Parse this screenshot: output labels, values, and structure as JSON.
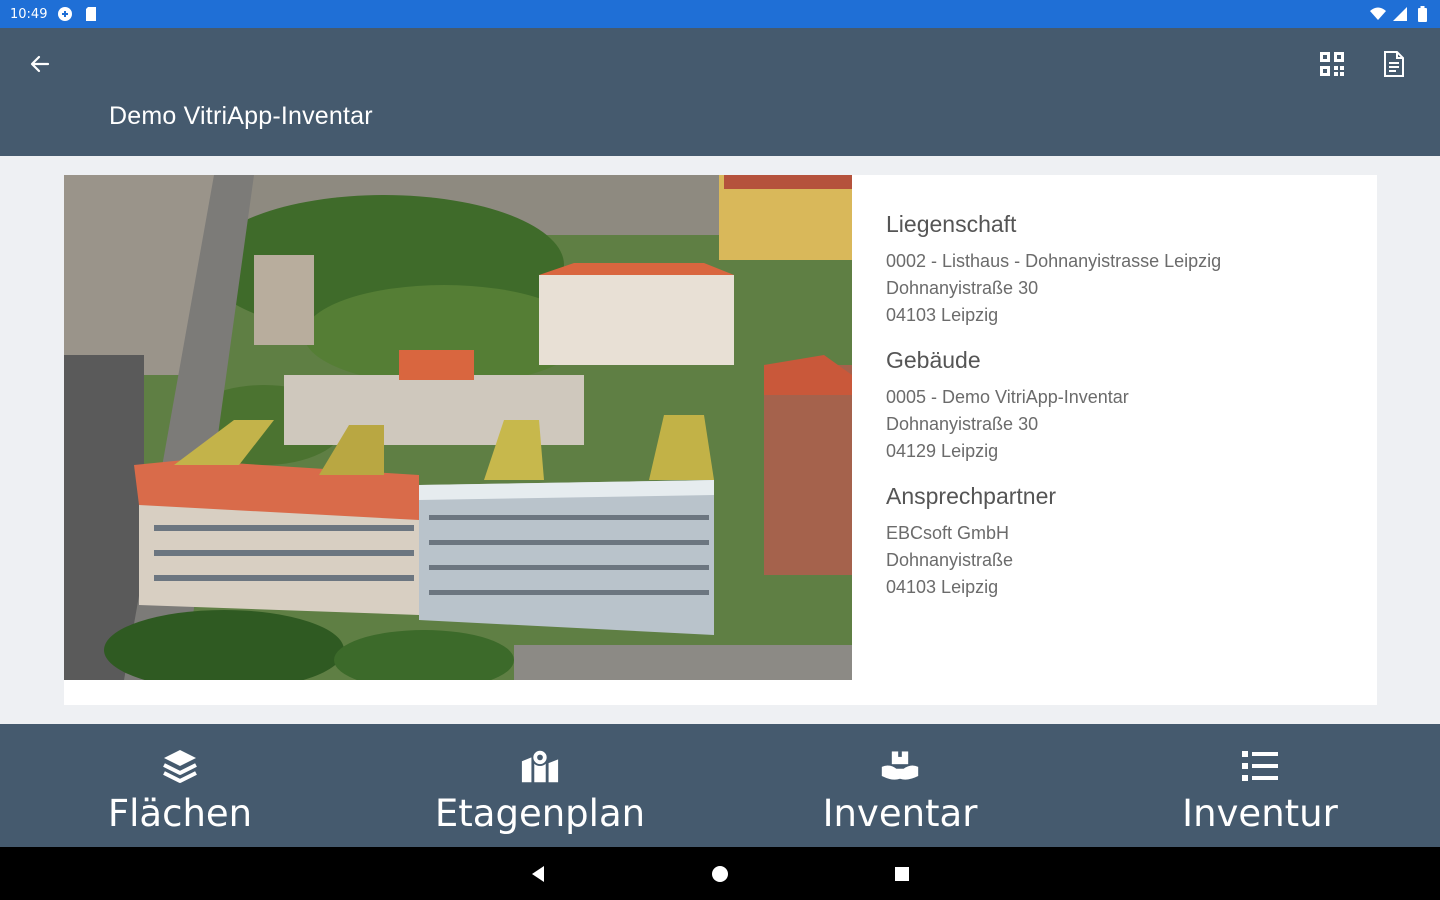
{
  "status_bar": {
    "time": "10:49"
  },
  "app_bar": {
    "title": "Demo VitriApp-Inventar"
  },
  "details": {
    "sections": [
      {
        "heading": "Liegenschaft",
        "lines": [
          "0002 - Listhaus - Dohnanyistrasse Leipzig",
          "Dohnanyistraße 30",
          "04103 Leipzig"
        ]
      },
      {
        "heading": "Gebäude",
        "lines": [
          "0005 - Demo VitriApp-Inventar",
          "Dohnanyistraße 30",
          "04129 Leipzig"
        ]
      },
      {
        "heading": "Ansprechpartner",
        "lines": [
          "EBCsoft GmbH",
          "Dohnanyistraße",
          "04103 Leipzig"
        ]
      }
    ]
  },
  "bottom_nav": {
    "items": [
      {
        "label": "Flächen",
        "icon": "layers-icon"
      },
      {
        "label": "Etagenplan",
        "icon": "map-marker-icon"
      },
      {
        "label": "Inventar",
        "icon": "box-hands-icon"
      },
      {
        "label": "Inventur",
        "icon": "list-icon"
      }
    ]
  },
  "colors": {
    "status_bar": "#1f6fd6",
    "app_bar": "#455a6e",
    "background": "#eef0f3",
    "card": "#ffffff",
    "system_nav": "#000000"
  }
}
